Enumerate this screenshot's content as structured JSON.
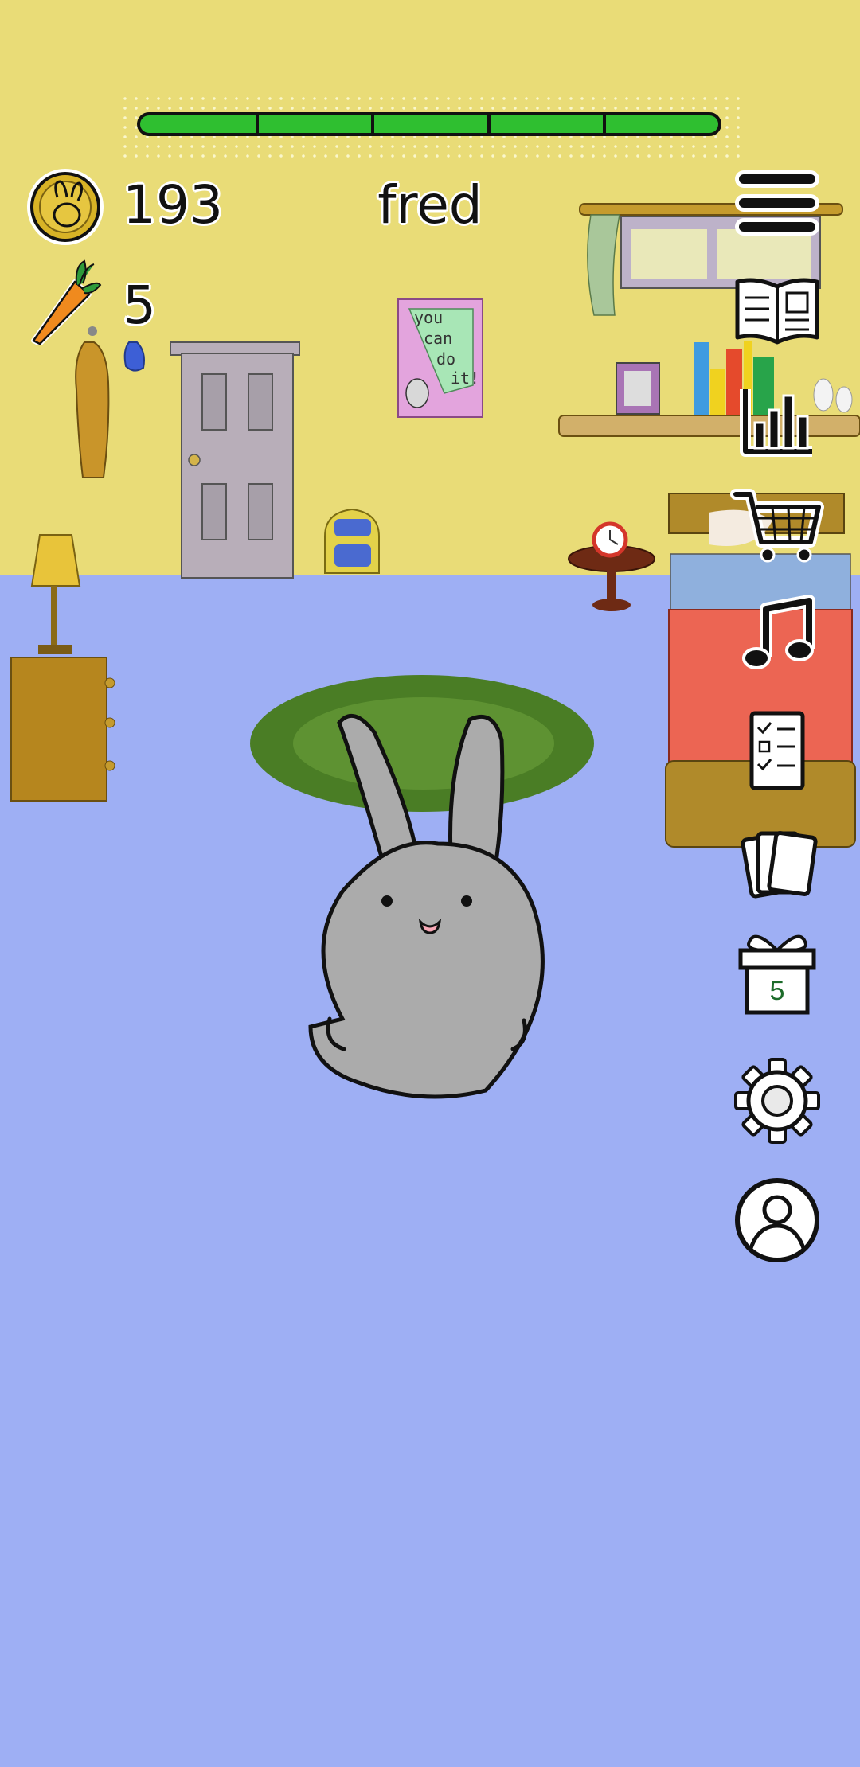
{
  "hud": {
    "coins": "193",
    "carrots": "5",
    "pet_name": "fred",
    "health_fraction": 1.0,
    "health_segments": 5
  },
  "room": {
    "poster_lines": [
      "you",
      "can",
      "do",
      "it!"
    ]
  },
  "side_menu": {
    "items": [
      {
        "name": "menu",
        "icon": "hamburger-menu-icon"
      },
      {
        "name": "journal",
        "icon": "open-book-icon"
      },
      {
        "name": "stats",
        "icon": "bar-chart-icon"
      },
      {
        "name": "shop",
        "icon": "shopping-cart-icon"
      },
      {
        "name": "music",
        "icon": "music-note-icon"
      },
      {
        "name": "tasks",
        "icon": "checklist-icon"
      },
      {
        "name": "cards",
        "icon": "cards-icon"
      },
      {
        "name": "gift",
        "icon": "gift-icon",
        "badge": "5"
      },
      {
        "name": "settings",
        "icon": "gear-icon"
      },
      {
        "name": "profile",
        "icon": "profile-icon"
      }
    ]
  },
  "colors": {
    "wall": "#e9dc77",
    "floor": "#9eaff4",
    "health": "#2fbf30",
    "bunny": "#ababab",
    "rug_outer": "#4a7d25",
    "rug_inner": "#5e9232",
    "bed_blanket": "#ec6553"
  }
}
